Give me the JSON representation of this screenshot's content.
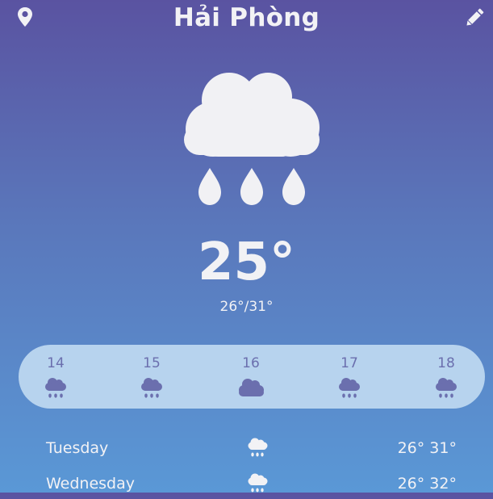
{
  "header": {
    "city": "Hải Phòng",
    "location_icon": "map-pin-icon",
    "edit_icon": "pencil-icon"
  },
  "current": {
    "condition_icon": "rain-cloud-icon",
    "temperature": "25°",
    "range": "26°/31°"
  },
  "hourly": [
    {
      "label": "14",
      "icon": "rain-icon"
    },
    {
      "label": "15",
      "icon": "rain-icon"
    },
    {
      "label": "16",
      "icon": "cloud-icon"
    },
    {
      "label": "17",
      "icon": "rain-icon"
    },
    {
      "label": "18",
      "icon": "rain-icon"
    }
  ],
  "daily": [
    {
      "day": "Tuesday",
      "icon": "rain-icon",
      "temps": "26° 31°"
    },
    {
      "day": "Wednesday",
      "icon": "rain-icon",
      "temps": "26° 32°"
    }
  ],
  "colors": {
    "background_top": "#5a53a1",
    "background_bottom": "#5a98d6",
    "hourly_strip": "#b7d3ee",
    "hourly_accent": "#6b6fae",
    "text": "#f2f2f5"
  }
}
